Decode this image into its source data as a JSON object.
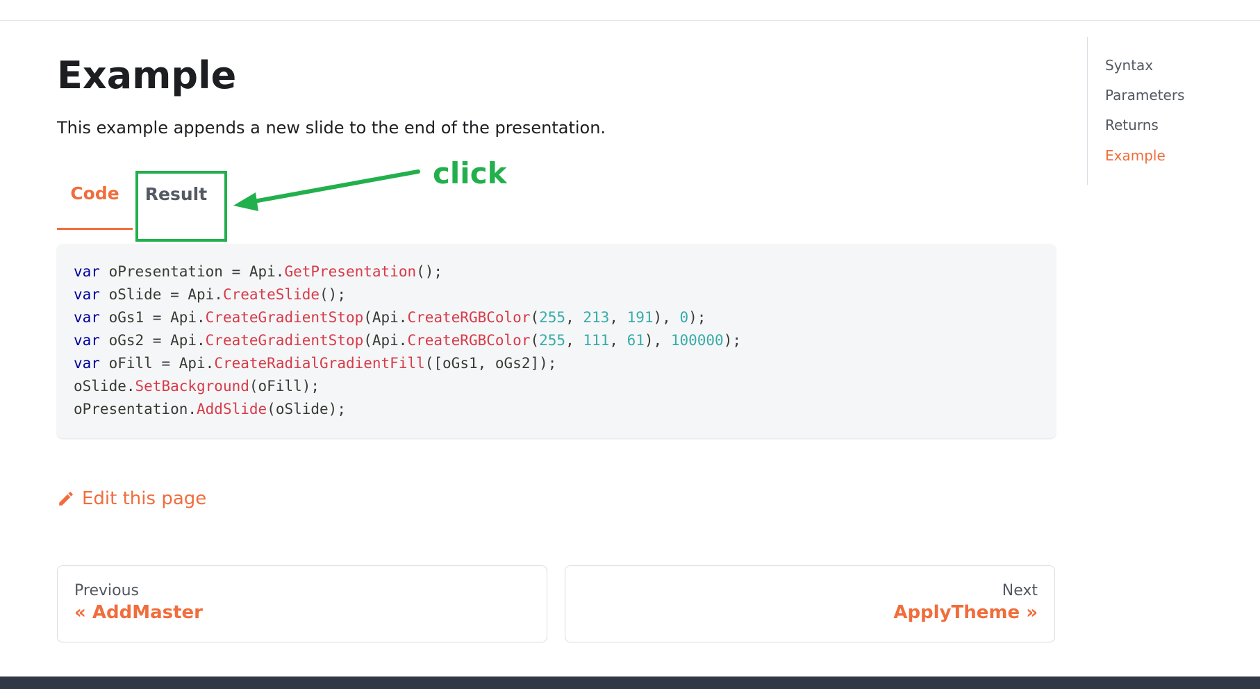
{
  "page": {
    "title": "Example",
    "description": "This example appends a new slide to the end of the presentation."
  },
  "tabs": [
    {
      "label": "Code",
      "active": true
    },
    {
      "label": "Result",
      "active": false
    }
  ],
  "annotation": {
    "label": "click",
    "color": "#22b04c"
  },
  "code": {
    "lines": [
      [
        [
          "kw",
          "var"
        ],
        [
          "plain",
          " oPresentation = Api."
        ],
        [
          "fn",
          "GetPresentation"
        ],
        [
          "plain",
          "();"
        ]
      ],
      [
        [
          "kw",
          "var"
        ],
        [
          "plain",
          " oSlide = Api."
        ],
        [
          "fn",
          "CreateSlide"
        ],
        [
          "plain",
          "();"
        ]
      ],
      [
        [
          "kw",
          "var"
        ],
        [
          "plain",
          " oGs1 = Api."
        ],
        [
          "fn",
          "CreateGradientStop"
        ],
        [
          "plain",
          "(Api."
        ],
        [
          "fn",
          "CreateRGBColor"
        ],
        [
          "plain",
          "("
        ],
        [
          "num",
          "255"
        ],
        [
          "plain",
          ", "
        ],
        [
          "num",
          "213"
        ],
        [
          "plain",
          ", "
        ],
        [
          "num",
          "191"
        ],
        [
          "plain",
          "), "
        ],
        [
          "num",
          "0"
        ],
        [
          "plain",
          ");"
        ]
      ],
      [
        [
          "kw",
          "var"
        ],
        [
          "plain",
          " oGs2 = Api."
        ],
        [
          "fn",
          "CreateGradientStop"
        ],
        [
          "plain",
          "(Api."
        ],
        [
          "fn",
          "CreateRGBColor"
        ],
        [
          "plain",
          "("
        ],
        [
          "num",
          "255"
        ],
        [
          "plain",
          ", "
        ],
        [
          "num",
          "111"
        ],
        [
          "plain",
          ", "
        ],
        [
          "num",
          "61"
        ],
        [
          "plain",
          "), "
        ],
        [
          "num",
          "100000"
        ],
        [
          "plain",
          ");"
        ]
      ],
      [
        [
          "kw",
          "var"
        ],
        [
          "plain",
          " oFill = Api."
        ],
        [
          "fn",
          "CreateRadialGradientFill"
        ],
        [
          "plain",
          "([oGs1, oGs2]);"
        ]
      ],
      [
        [
          "plain",
          "oSlide."
        ],
        [
          "fn",
          "SetBackground"
        ],
        [
          "plain",
          "(oFill);"
        ]
      ],
      [
        [
          "plain",
          "oPresentation."
        ],
        [
          "fn",
          "AddSlide"
        ],
        [
          "plain",
          "(oSlide);"
        ]
      ]
    ]
  },
  "edit_link": {
    "label": "Edit this page",
    "icon": "pencil-icon"
  },
  "pagination": {
    "prev": {
      "sub": "Previous",
      "label": "« AddMaster"
    },
    "next": {
      "sub": "Next",
      "label": "ApplyTheme »"
    }
  },
  "toc": {
    "items": [
      {
        "label": "Syntax",
        "active": false
      },
      {
        "label": "Parameters",
        "active": false
      },
      {
        "label": "Returns",
        "active": false
      },
      {
        "label": "Example",
        "active": true
      }
    ]
  },
  "colors": {
    "accent": "#f06d3c",
    "keyword": "#00009f",
    "function": "#d73a49",
    "number": "#36acaa"
  }
}
